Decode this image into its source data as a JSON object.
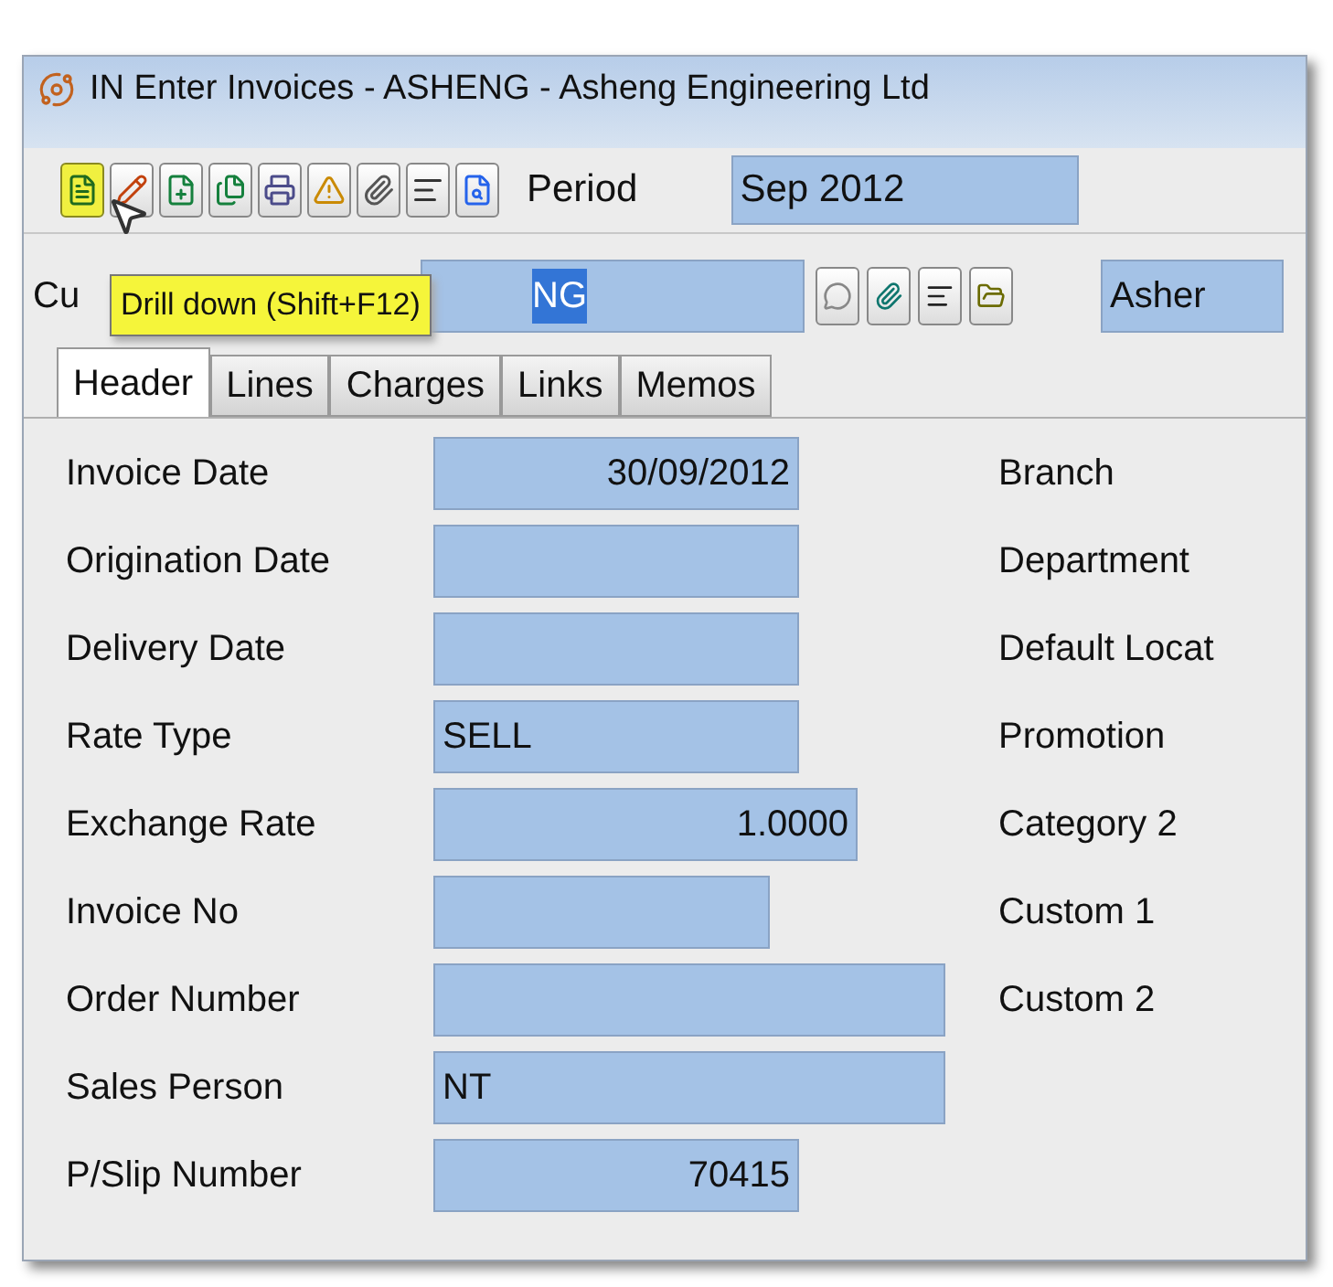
{
  "window": {
    "title": "IN Enter Invoices - ASHENG - Asheng Engineering Ltd"
  },
  "toolbar": {
    "buttons": [
      {
        "kind": "drill",
        "selected": true
      },
      {
        "kind": "edit",
        "selected": false
      },
      {
        "kind": "add",
        "selected": false
      },
      {
        "kind": "copy",
        "selected": false
      },
      {
        "kind": "print",
        "selected": false
      },
      {
        "kind": "warning",
        "selected": false
      },
      {
        "kind": "attach",
        "selected": false
      },
      {
        "kind": "text",
        "selected": false
      },
      {
        "kind": "search",
        "selected": false
      }
    ],
    "period_label": "Period",
    "period_value": "Sep 2012"
  },
  "customer": {
    "label": "Cu",
    "value": "NG",
    "name": "Asher"
  },
  "tooltip": "Drill down (Shift+F12)",
  "tabs": [
    {
      "label": "Header",
      "selected": true
    },
    {
      "label": "Lines",
      "selected": false
    },
    {
      "label": "Charges",
      "selected": false
    },
    {
      "label": "Links",
      "selected": false
    },
    {
      "label": "Memos",
      "selected": false
    }
  ],
  "fields": [
    {
      "label": "Invoice Date",
      "value": "30/09/2012"
    },
    {
      "label": "Origination Date"
    },
    {
      "label": "Delivery Date"
    },
    {
      "label": "Rate Type",
      "value": "SELL"
    },
    {
      "label": "Exchange Rate",
      "value": "1.0000"
    },
    {
      "label": "Invoice No"
    },
    {
      "label": "Order Number"
    },
    {
      "label": "Sales Person",
      "value": "NT"
    },
    {
      "label": "P/Slip Number",
      "value": "70415"
    }
  ],
  "right_labels": [
    "Branch",
    "Department",
    "Default Locat",
    "Promotion",
    "Category 2",
    "Custom 1",
    "Custom 2"
  ]
}
